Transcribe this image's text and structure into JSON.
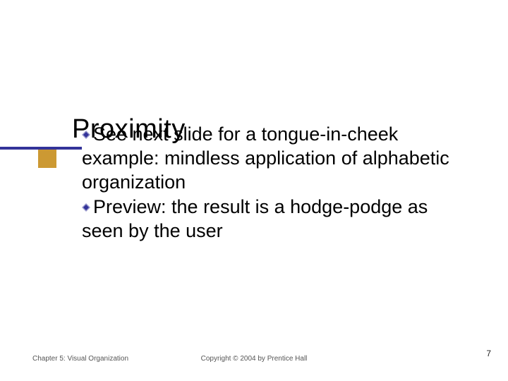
{
  "title": "Proximity",
  "bullets": [
    "See next slide for a tongue-in-cheek example: mindless application of alphabetic organization",
    "Preview: the result is a hodge-podge as seen by the user"
  ],
  "footer": {
    "left": "Chapter 5: Visual Organization",
    "center": "Copyright © 2004 by Prentice Hall",
    "right": "7"
  },
  "colors": {
    "rule": "#333399",
    "square": "#cc9933",
    "bullet_fill": "#333399",
    "bullet_edge": "#9a9acc"
  }
}
